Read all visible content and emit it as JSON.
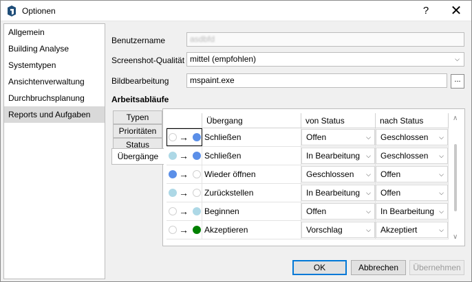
{
  "window": {
    "title": "Optionen",
    "help": "?",
    "close": "✕"
  },
  "sidebar": {
    "items": [
      {
        "label": "Allgemein"
      },
      {
        "label": "Building Analyse"
      },
      {
        "label": "Systemtypen"
      },
      {
        "label": "Ansichtenverwaltung"
      },
      {
        "label": "Durchbruchsplanung"
      },
      {
        "label": "Reports und Aufgaben"
      }
    ],
    "selected_index": 5
  },
  "form": {
    "username_label": "Benutzername",
    "username_value": "asdbfd",
    "quality_label": "Screenshot-Qualität",
    "quality_value": "mittel (empfohlen)",
    "editor_label": "Bildbearbeitung",
    "editor_value": "mspaint.exe",
    "browse_label": "..."
  },
  "workflows": {
    "title": "Arbeitsabläufe",
    "tabs": [
      {
        "label": "Typen"
      },
      {
        "label": "Prioritäten"
      },
      {
        "label": "Status"
      },
      {
        "label": "Übergänge"
      }
    ],
    "active_tab": "Übergänge",
    "columns": [
      "",
      "Übergang",
      "von Status",
      "nach Status"
    ],
    "arrow": "→",
    "rows": [
      {
        "from_color": "#ffffff",
        "to_color": "#5b8fe8",
        "name": "Schließen",
        "von": "Offen",
        "nach": "Geschlossen"
      },
      {
        "from_color": "#add8e6",
        "to_color": "#5b8fe8",
        "name": "Schließen",
        "von": "In Bearbeitung",
        "nach": "Geschlossen"
      },
      {
        "from_color": "#5b8fe8",
        "to_color": "#ffffff",
        "name": "Wieder öffnen",
        "von": "Geschlossen",
        "nach": "Offen"
      },
      {
        "from_color": "#add8e6",
        "to_color": "#ffffff",
        "name": "Zurückstellen",
        "von": "In Bearbeitung",
        "nach": "Offen"
      },
      {
        "from_color": "#ffffff",
        "to_color": "#add8e6",
        "name": "Beginnen",
        "von": "Offen",
        "nach": "In Bearbeitung"
      },
      {
        "from_color": "#ffffff",
        "to_color": "#008000",
        "name": "Akzeptieren",
        "von": "Vorschlag",
        "nach": "Akzeptiert"
      }
    ]
  },
  "buttons": {
    "ok": "OK",
    "cancel": "Abbrechen",
    "apply": "Übernehmen"
  }
}
